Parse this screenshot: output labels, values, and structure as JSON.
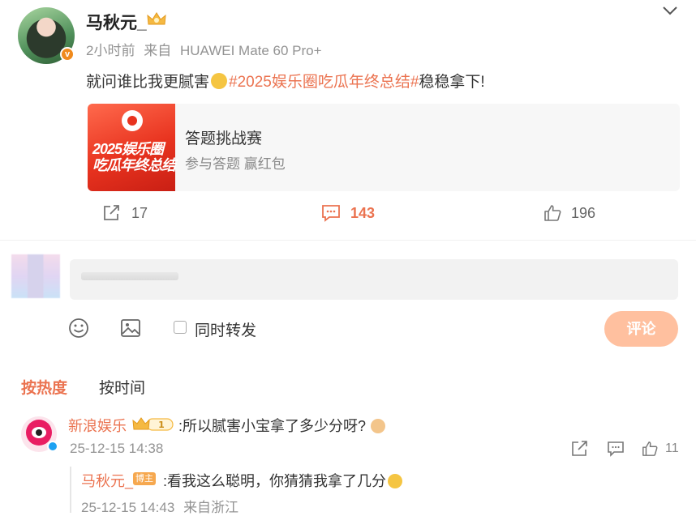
{
  "post": {
    "author": "马秋元_",
    "time": "2小时前",
    "source_prefix": "来自",
    "device": "HUAWEI Mate 60 Pro+",
    "text_before": "就问谁比我更腻害",
    "topic": "#2025娱乐圈吃瓜年终总结#",
    "text_after": "稳稳拿下!",
    "card": {
      "title": "答题挑战赛",
      "subtitle": "参与答题 赢红包",
      "image_line1": "2025娱乐圈",
      "image_line2": "吃瓜年终总结"
    },
    "stats": {
      "reposts": "17",
      "comments": "143",
      "likes": "196"
    }
  },
  "composer": {
    "repost_label": "同时转发",
    "submit_label": "评论"
  },
  "sort_tabs": {
    "hot": "按热度",
    "time": "按时间"
  },
  "comment": {
    "user": "新浪娱乐",
    "text": ":所以腻害小宝拿了多少分呀?",
    "time": "25-12-15 14:38",
    "likes": "11",
    "level_badge": "1"
  },
  "reply": {
    "user": "马秋元_",
    "tag": "博主",
    "text": ":看我这么聪明，你猜猜我拿了几分",
    "time": "25-12-15 14:43",
    "location": "来自浙江"
  },
  "colors": {
    "accent": "#eb7350",
    "verified": "#f08a1c",
    "submit_bg": "#ffc09f"
  },
  "icons": [
    "chevron-down-icon",
    "repost-icon",
    "comment-icon",
    "like-icon",
    "emoji-icon",
    "image-icon",
    "crown-icon"
  ]
}
